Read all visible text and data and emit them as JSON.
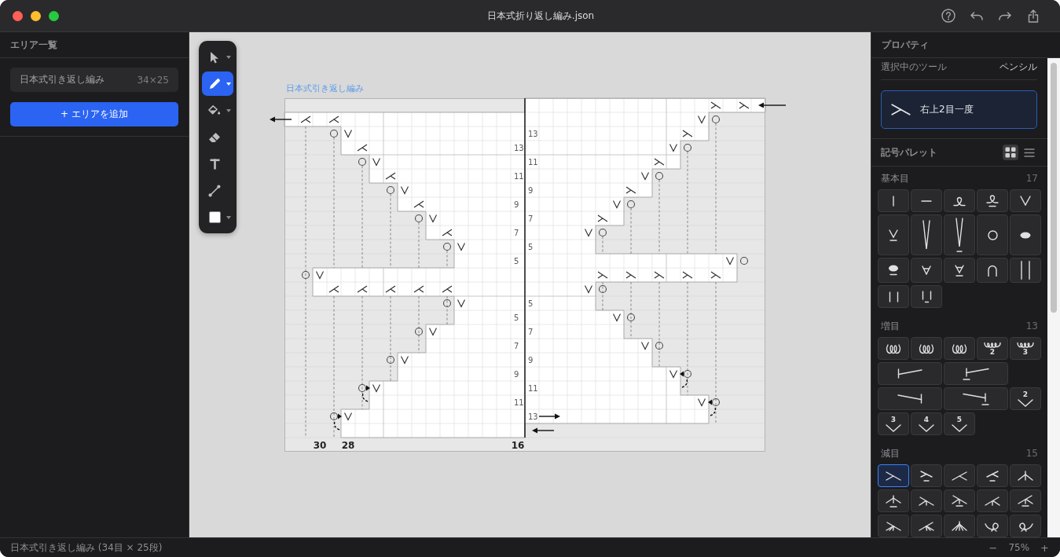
{
  "window": {
    "title": "日本式折り返し編み.json"
  },
  "title_bar_actions": [
    {
      "kind": "help"
    },
    {
      "kind": "undo"
    },
    {
      "kind": "redo"
    },
    {
      "kind": "share"
    }
  ],
  "area_panel": {
    "title": "エリア一覧",
    "areas": [
      {
        "name": "日本式引き返し編み",
        "size": "34×25",
        "selected": true
      }
    ],
    "add_button": "+ エリアを追加"
  },
  "toolbar": {
    "tools": [
      {
        "kind": "select",
        "selected": false,
        "menu": true
      },
      {
        "kind": "pencil",
        "selected": true,
        "menu": true
      },
      {
        "kind": "fill",
        "selected": false,
        "menu": true
      },
      {
        "kind": "eraser",
        "selected": false,
        "menu": false
      },
      {
        "kind": "text",
        "selected": false,
        "menu": false
      },
      {
        "kind": "line",
        "selected": false,
        "menu": false
      },
      {
        "kind": "color",
        "selected": false,
        "menu": true,
        "color": "#ffffff"
      }
    ]
  },
  "chart": {
    "title": "日本式引き返し編み",
    "left_row_numbers": [
      "13",
      "11",
      "9",
      "7",
      "5",
      "5",
      "7",
      "9",
      "11"
    ],
    "right_row_numbers": [
      "13",
      "11",
      "9",
      "7",
      "5",
      "5",
      "7",
      "9",
      "11",
      "13"
    ],
    "column_numbers": [
      "30",
      "28",
      "16"
    ]
  },
  "properties_panel": {
    "title": "プロパティ",
    "current_tool": {
      "label": "選択中のツール",
      "value": "ペンシル"
    },
    "selected_symbol": {
      "kind": "ssk",
      "name": "右上2目一度"
    },
    "palette": {
      "title": "記号パレット",
      "views": [
        {
          "kind": "grid",
          "selected": true
        },
        {
          "kind": "list",
          "selected": false
        }
      ],
      "sections": [
        {
          "name": "基本目",
          "count": "17",
          "symbols": [
            {
              "kind": "knit",
              "selected": false
            },
            {
              "kind": "purl",
              "selected": false
            },
            {
              "kind": "twisted",
              "selected": false
            },
            {
              "kind": "twistedpurl",
              "selected": false
            },
            {
              "kind": "slip",
              "selected": false
            },
            {
              "kind": "slippurl",
              "selected": false
            },
            {
              "kind": "tallslip",
              "selected": false
            },
            {
              "kind": "tallslippurl",
              "selected": false
            },
            {
              "kind": "yarnover",
              "selected": false
            },
            {
              "kind": "bobble",
              "selected": false
            },
            {
              "kind": "bobblepurl",
              "selected": false
            },
            {
              "kind": "pulled",
              "selected": false
            },
            {
              "kind": "pulledpurl",
              "selected": false
            },
            {
              "kind": "cap",
              "selected": false
            },
            {
              "kind": "doublebar",
              "selected": false
            },
            {
              "kind": "twobars",
              "selected": false
            },
            {
              "kind": "barspurl",
              "selected": false
            }
          ]
        },
        {
          "name": "増目",
          "count": "13",
          "symbols": [
            {
              "kind": "loops",
              "selected": false
            },
            {
              "kind": "loops",
              "selected": false
            },
            {
              "kind": "loops",
              "selected": false
            },
            {
              "kind": "multiloop",
              "number": "2",
              "selected": false
            },
            {
              "kind": "multiloop",
              "number": "3",
              "selected": false
            },
            {
              "kind": "leftinc",
              "selected": false
            },
            {
              "kind": "leftincpurl",
              "selected": false
            },
            {
              "kind": "rightinc",
              "selected": false
            },
            {
              "kind": "rightincpurl",
              "selected": false
            },
            {
              "kind": "vinc",
              "number": "2",
              "selected": false
            },
            {
              "kind": "vinc",
              "number": "3",
              "selected": false
            },
            {
              "kind": "vinc",
              "number": "4",
              "selected": false
            },
            {
              "kind": "vinc",
              "number": "5",
              "selected": false
            }
          ]
        },
        {
          "name": "減目",
          "count": "15",
          "symbols": [
            {
              "kind": "ssk",
              "selected": true
            },
            {
              "kind": "sskpurl",
              "selected": false
            },
            {
              "kind": "k2tog",
              "selected": false
            },
            {
              "kind": "k2togpurl",
              "selected": false
            },
            {
              "kind": "cdd",
              "selected": false
            },
            {
              "kind": "cddpurl",
              "selected": false
            },
            {
              "kind": "sk2p",
              "selected": false
            },
            {
              "kind": "sk2ppurl",
              "selected": false
            },
            {
              "kind": "k3tog",
              "selected": false
            },
            {
              "kind": "k3togpurl",
              "selected": false
            },
            {
              "kind": "sk3p",
              "selected": false
            },
            {
              "kind": "k4tog",
              "selected": false
            },
            {
              "kind": "c4d",
              "selected": false
            },
            {
              "kind": "knotright",
              "selected": false
            },
            {
              "kind": "knotleft",
              "selected": false
            }
          ]
        }
      ]
    }
  },
  "status_bar": {
    "text": "日本式引き返し編み (34目 × 25段)",
    "zoom_out": "−",
    "zoom": "75%",
    "zoom_in": "+"
  }
}
